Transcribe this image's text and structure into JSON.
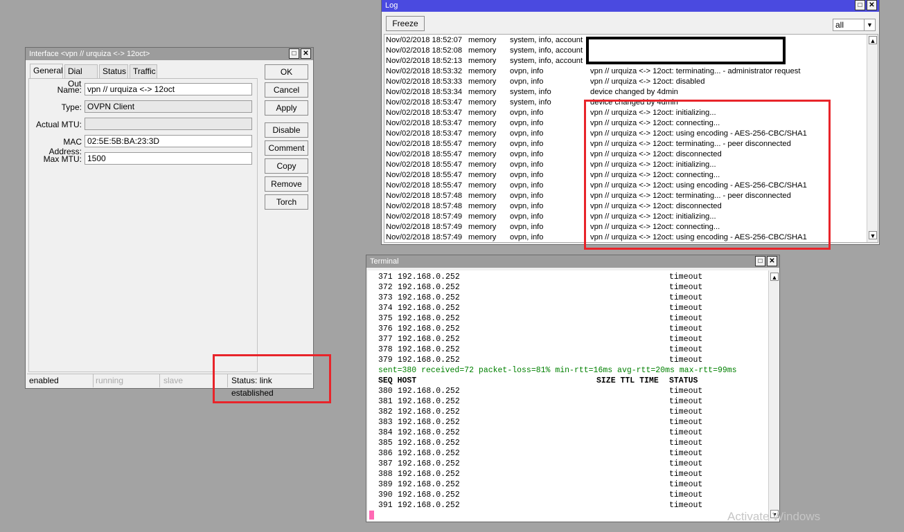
{
  "interface_window": {
    "title": "Interface <vpn // urquiza <-> 12oct>",
    "tabs": [
      "General",
      "Dial Out",
      "Status",
      "Traffic"
    ],
    "fields": {
      "name_label": "Name:",
      "name_value": "vpn // urquiza <-> 12oct",
      "type_label": "Type:",
      "type_value": "OVPN Client",
      "mtu_label": "Actual MTU:",
      "mtu_value": "",
      "mac_label": "MAC Address:",
      "mac_value": "02:5E:5B:BA:23:3D",
      "maxmtu_label": "Max MTU:",
      "maxmtu_value": "1500"
    },
    "buttons": [
      "OK",
      "Cancel",
      "Apply",
      "Disable",
      "Comment",
      "Copy",
      "Remove",
      "Torch"
    ],
    "statusbar": [
      "enabled",
      "running",
      "slave",
      "Status: link established"
    ]
  },
  "log_window": {
    "title": "Log",
    "freeze_label": "Freeze",
    "filter_value": "all",
    "rows": [
      [
        "Nov/02/2018 18:52:07",
        "memory",
        "system, info, account",
        ""
      ],
      [
        "Nov/02/2018 18:52:08",
        "memory",
        "system, info, account",
        ""
      ],
      [
        "Nov/02/2018 18:52:13",
        "memory",
        "system, info, account",
        ""
      ],
      [
        "Nov/02/2018 18:53:32",
        "memory",
        "ovpn, info",
        "vpn // urquiza <-> 12oct: terminating... - administrator request"
      ],
      [
        "Nov/02/2018 18:53:33",
        "memory",
        "ovpn, info",
        "vpn // urquiza <-> 12oct: disabled"
      ],
      [
        "Nov/02/2018 18:53:34",
        "memory",
        "system, info",
        "device changed by 4dmin"
      ],
      [
        "Nov/02/2018 18:53:47",
        "memory",
        "system, info",
        "device changed by 4dmin"
      ],
      [
        "Nov/02/2018 18:53:47",
        "memory",
        "ovpn, info",
        "vpn // urquiza <-> 12oct: initializing..."
      ],
      [
        "Nov/02/2018 18:53:47",
        "memory",
        "ovpn, info",
        "vpn // urquiza <-> 12oct: connecting..."
      ],
      [
        "Nov/02/2018 18:53:47",
        "memory",
        "ovpn, info",
        "vpn // urquiza <-> 12oct: using encoding - AES-256-CBC/SHA1"
      ],
      [
        "Nov/02/2018 18:55:47",
        "memory",
        "ovpn, info",
        "vpn // urquiza <-> 12oct: terminating... - peer disconnected"
      ],
      [
        "Nov/02/2018 18:55:47",
        "memory",
        "ovpn, info",
        "vpn // urquiza <-> 12oct: disconnected"
      ],
      [
        "Nov/02/2018 18:55:47",
        "memory",
        "ovpn, info",
        "vpn // urquiza <-> 12oct: initializing..."
      ],
      [
        "Nov/02/2018 18:55:47",
        "memory",
        "ovpn, info",
        "vpn // urquiza <-> 12oct: connecting..."
      ],
      [
        "Nov/02/2018 18:55:47",
        "memory",
        "ovpn, info",
        "vpn // urquiza <-> 12oct: using encoding - AES-256-CBC/SHA1"
      ],
      [
        "Nov/02/2018 18:57:48",
        "memory",
        "ovpn, info",
        "vpn // urquiza <-> 12oct: terminating... - peer disconnected"
      ],
      [
        "Nov/02/2018 18:57:48",
        "memory",
        "ovpn, info",
        "vpn // urquiza <-> 12oct: disconnected"
      ],
      [
        "Nov/02/2018 18:57:49",
        "memory",
        "ovpn, info",
        "vpn // urquiza <-> 12oct: initializing..."
      ],
      [
        "Nov/02/2018 18:57:49",
        "memory",
        "ovpn, info",
        "vpn // urquiza <-> 12oct: connecting..."
      ],
      [
        "Nov/02/2018 18:57:49",
        "memory",
        "ovpn, info",
        "vpn // urquiza <-> 12oct: using encoding - AES-256-CBC/SHA1"
      ]
    ]
  },
  "terminal_window": {
    "title": "Terminal",
    "lines_before": [
      [
        "371",
        "192.168.0.252",
        "timeout"
      ],
      [
        "372",
        "192.168.0.252",
        "timeout"
      ],
      [
        "373",
        "192.168.0.252",
        "timeout"
      ],
      [
        "374",
        "192.168.0.252",
        "timeout"
      ],
      [
        "375",
        "192.168.0.252",
        "timeout"
      ],
      [
        "376",
        "192.168.0.252",
        "timeout"
      ],
      [
        "377",
        "192.168.0.252",
        "timeout"
      ],
      [
        "378",
        "192.168.0.252",
        "timeout"
      ],
      [
        "379",
        "192.168.0.252",
        "timeout"
      ]
    ],
    "summary": "sent=380 received=72 packet-loss=81% min-rtt=16ms avg-rtt=20ms max-rtt=99ms",
    "header": {
      "seq_host": "SEQ HOST",
      "size_ttl_time": "SIZE TTL TIME",
      "status": "STATUS"
    },
    "lines_after": [
      [
        "380",
        "192.168.0.252",
        "timeout"
      ],
      [
        "381",
        "192.168.0.252",
        "timeout"
      ],
      [
        "382",
        "192.168.0.252",
        "timeout"
      ],
      [
        "383",
        "192.168.0.252",
        "timeout"
      ],
      [
        "384",
        "192.168.0.252",
        "timeout"
      ],
      [
        "385",
        "192.168.0.252",
        "timeout"
      ],
      [
        "386",
        "192.168.0.252",
        "timeout"
      ],
      [
        "387",
        "192.168.0.252",
        "timeout"
      ],
      [
        "388",
        "192.168.0.252",
        "timeout"
      ],
      [
        "389",
        "192.168.0.252",
        "timeout"
      ],
      [
        "390",
        "192.168.0.252",
        "timeout"
      ],
      [
        "391",
        "192.168.0.252",
        "timeout"
      ]
    ]
  },
  "watermark": "Activate Windows",
  "colors": {
    "annotation_red": "#e8242a",
    "terminal_green": "#008000",
    "cursor_pink": "#ff69b4"
  }
}
